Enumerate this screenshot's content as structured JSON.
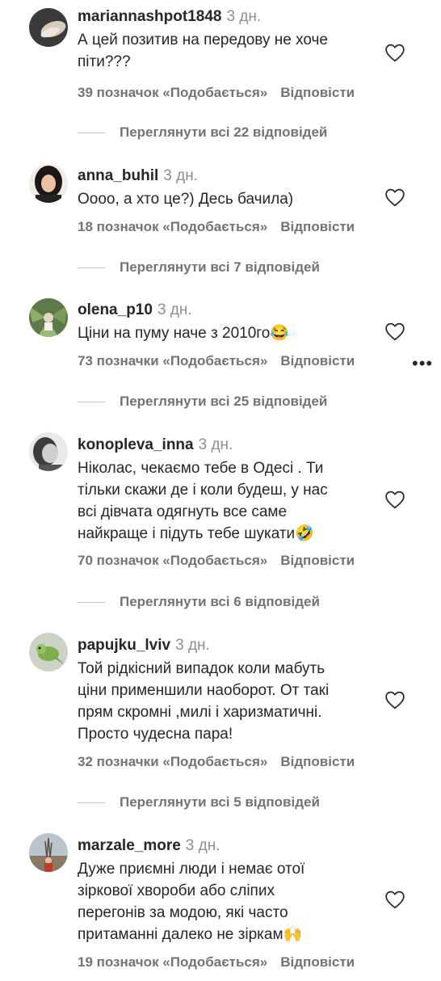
{
  "comments": [
    {
      "username": "mariannashpot1848",
      "time": "3 дн.",
      "lines": [
        "А цей позитив на передову не хоче",
        "піти???"
      ],
      "likes": "39 позначок «Подобається»",
      "reply": "Відповісти",
      "view_replies": "Переглянути всі 22 відповідей",
      "avatar": "avatar-hand-dark"
    },
    {
      "username": "anna_buhil",
      "time": "3 дн.",
      "lines": [
        "Оооо, а хто це?) Десь бачила)"
      ],
      "likes": "18 позначок «Подобається»",
      "reply": "Відповісти",
      "view_replies": "Переглянути всі 7 відповідей",
      "avatar": "avatar-woman-dark-hair"
    },
    {
      "username": "olena_p10",
      "time": "3 дн.",
      "lines": [
        "Ціни на пуму наче з 2010го😂"
      ],
      "likes": "73 позначки «Подобається»",
      "reply": "Відповісти",
      "view_replies": "Переглянути всі 25 відповідей",
      "avatar": "avatar-palm-leaves"
    },
    {
      "username": "konopleva_inna",
      "time": "3 дн.",
      "lines": [
        "Ніколас, чекаємо тебе в Одесі . Ти",
        "тільки скажи де і коли будеш, у нас",
        "всі дівчата одягнуть все саме",
        "найкраще і підуть тебе шукати🤣"
      ],
      "likes": "70 позначок «Подобається»",
      "reply": "Відповісти",
      "view_replies": "Переглянути всі 6 відповідей",
      "avatar": "avatar-woman-bw"
    },
    {
      "username": "papujku_lviv",
      "time": "3 дн.",
      "lines": [
        "Той рідкісний випадок коли мабуть",
        "ціни применшили наоборот. От такі",
        "прям скромні ,милі і харизматичні.",
        "Просто чудесна пара!"
      ],
      "likes": "32 позначки «Подобається»",
      "reply": "Відповісти",
      "view_replies": "Переглянути всі 5 відповідей",
      "avatar": "avatar-parrot"
    },
    {
      "username": "marzale_more",
      "time": "3 дн.",
      "lines": [
        "Дуже приємні люди і немає отої",
        "зіркової хвороби або сліпих",
        "перегонів за модою, які часто",
        "притаманні далеко не зіркам🙌"
      ],
      "likes": "19 позначок «Подобається»",
      "reply": "Відповісти",
      "avatar": "avatar-person-outdoor"
    }
  ],
  "more_icon": "•••",
  "colors": {
    "text": "#262626",
    "muted": "#737373",
    "time": "#8e8e8e"
  }
}
